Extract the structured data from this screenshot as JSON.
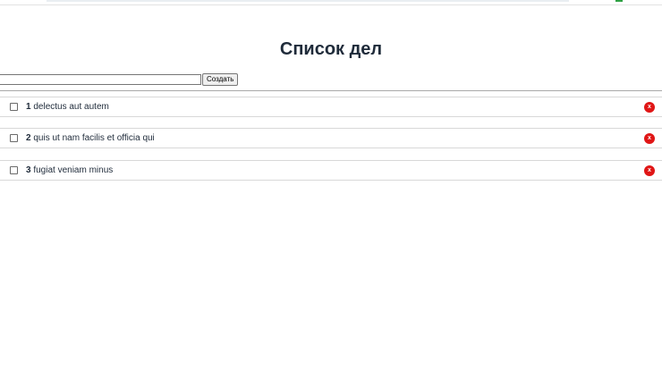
{
  "page": {
    "title": "Список дел"
  },
  "create_form": {
    "input_value": "",
    "button_label": "Создать"
  },
  "tasks": [
    {
      "number": "1",
      "text": "delectus aut autem",
      "completed": false,
      "delete_label": "x"
    },
    {
      "number": "2",
      "text": "quis ut nam facilis et officia qui",
      "completed": false,
      "delete_label": "x"
    },
    {
      "number": "3",
      "text": "fugiat veniam minus",
      "completed": false,
      "delete_label": "x"
    }
  ],
  "colors": {
    "delete_button": "#e01616",
    "title_text": "#1f2b3a",
    "topbar_indicator": "#2ea043"
  }
}
